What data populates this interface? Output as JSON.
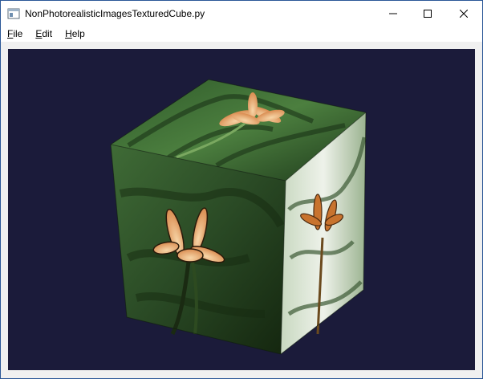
{
  "window": {
    "title": "NonPhotorealisticImagesTexturedCube.py",
    "controls": {
      "minimize_icon": "minimize-icon",
      "maximize_icon": "maximize-icon",
      "close_icon": "close-icon"
    }
  },
  "menubar": {
    "items": [
      {
        "mnemonic": "F",
        "rest": "ile"
      },
      {
        "mnemonic": "E",
        "rest": "dit"
      },
      {
        "mnemonic": "H",
        "rest": "elp"
      }
    ]
  },
  "viewport": {
    "background": "#1b1b3a",
    "content": "textured-cube"
  },
  "colors": {
    "title_border": "#2b5797",
    "leaf_dark": "#1f3a1c",
    "leaf_mid": "#3d6b32",
    "flower": "#f2b07a"
  }
}
